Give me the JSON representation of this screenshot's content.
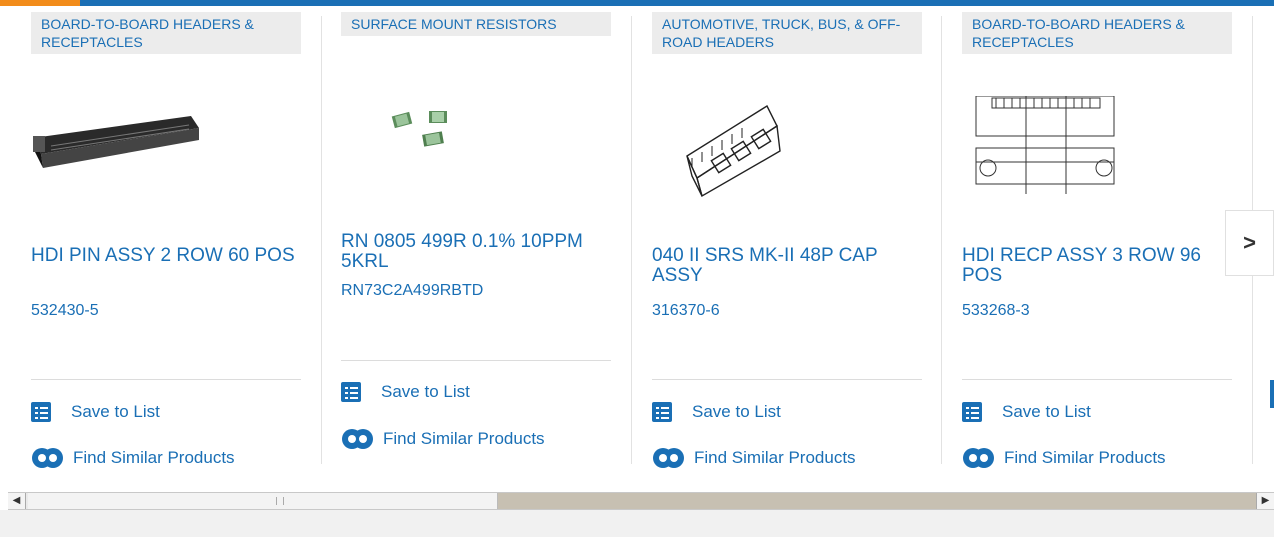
{
  "carousel": {
    "cards": [
      {
        "category": "BOARD-TO-BOARD HEADERS & RECEPTACLES",
        "title": "HDI PIN ASSY 2 ROW 60 POS",
        "part_number": "532430-5",
        "save_label": "Save to List",
        "similar_label": "Find Similar Products",
        "image_icon": "pin-header-image"
      },
      {
        "category": "SURFACE MOUNT RESISTORS",
        "title": "RN 0805 499R 0.1% 10PPM 5KRL",
        "part_number": "RN73C2A499RBTD",
        "save_label": "Save to List",
        "similar_label": "Find Similar Products",
        "image_icon": "smd-resistor-image"
      },
      {
        "category": "AUTOMOTIVE, TRUCK, BUS, & OFF-ROAD HEADERS",
        "title": "040 II SRS MK-II 48P CAP ASSY",
        "part_number": "316370-6",
        "save_label": "Save to List",
        "similar_label": "Find Similar Products",
        "image_icon": "automotive-header-image"
      },
      {
        "category": "BOARD-TO-BOARD HEADERS & RECEPTACLES",
        "title": "HDI RECP ASSY 3 ROW 96 POS",
        "part_number": "533268-3",
        "save_label": "Save to List",
        "similar_label": "Find Similar Products",
        "image_icon": "receptacle-drawing-image"
      }
    ],
    "next_label": ">"
  },
  "scrollbar": {
    "left_arrow": "◀",
    "right_arrow": "▶"
  },
  "colors": {
    "brand": "#1a6fb5",
    "accent": "#f28c1a",
    "category_bg": "#ececec"
  }
}
